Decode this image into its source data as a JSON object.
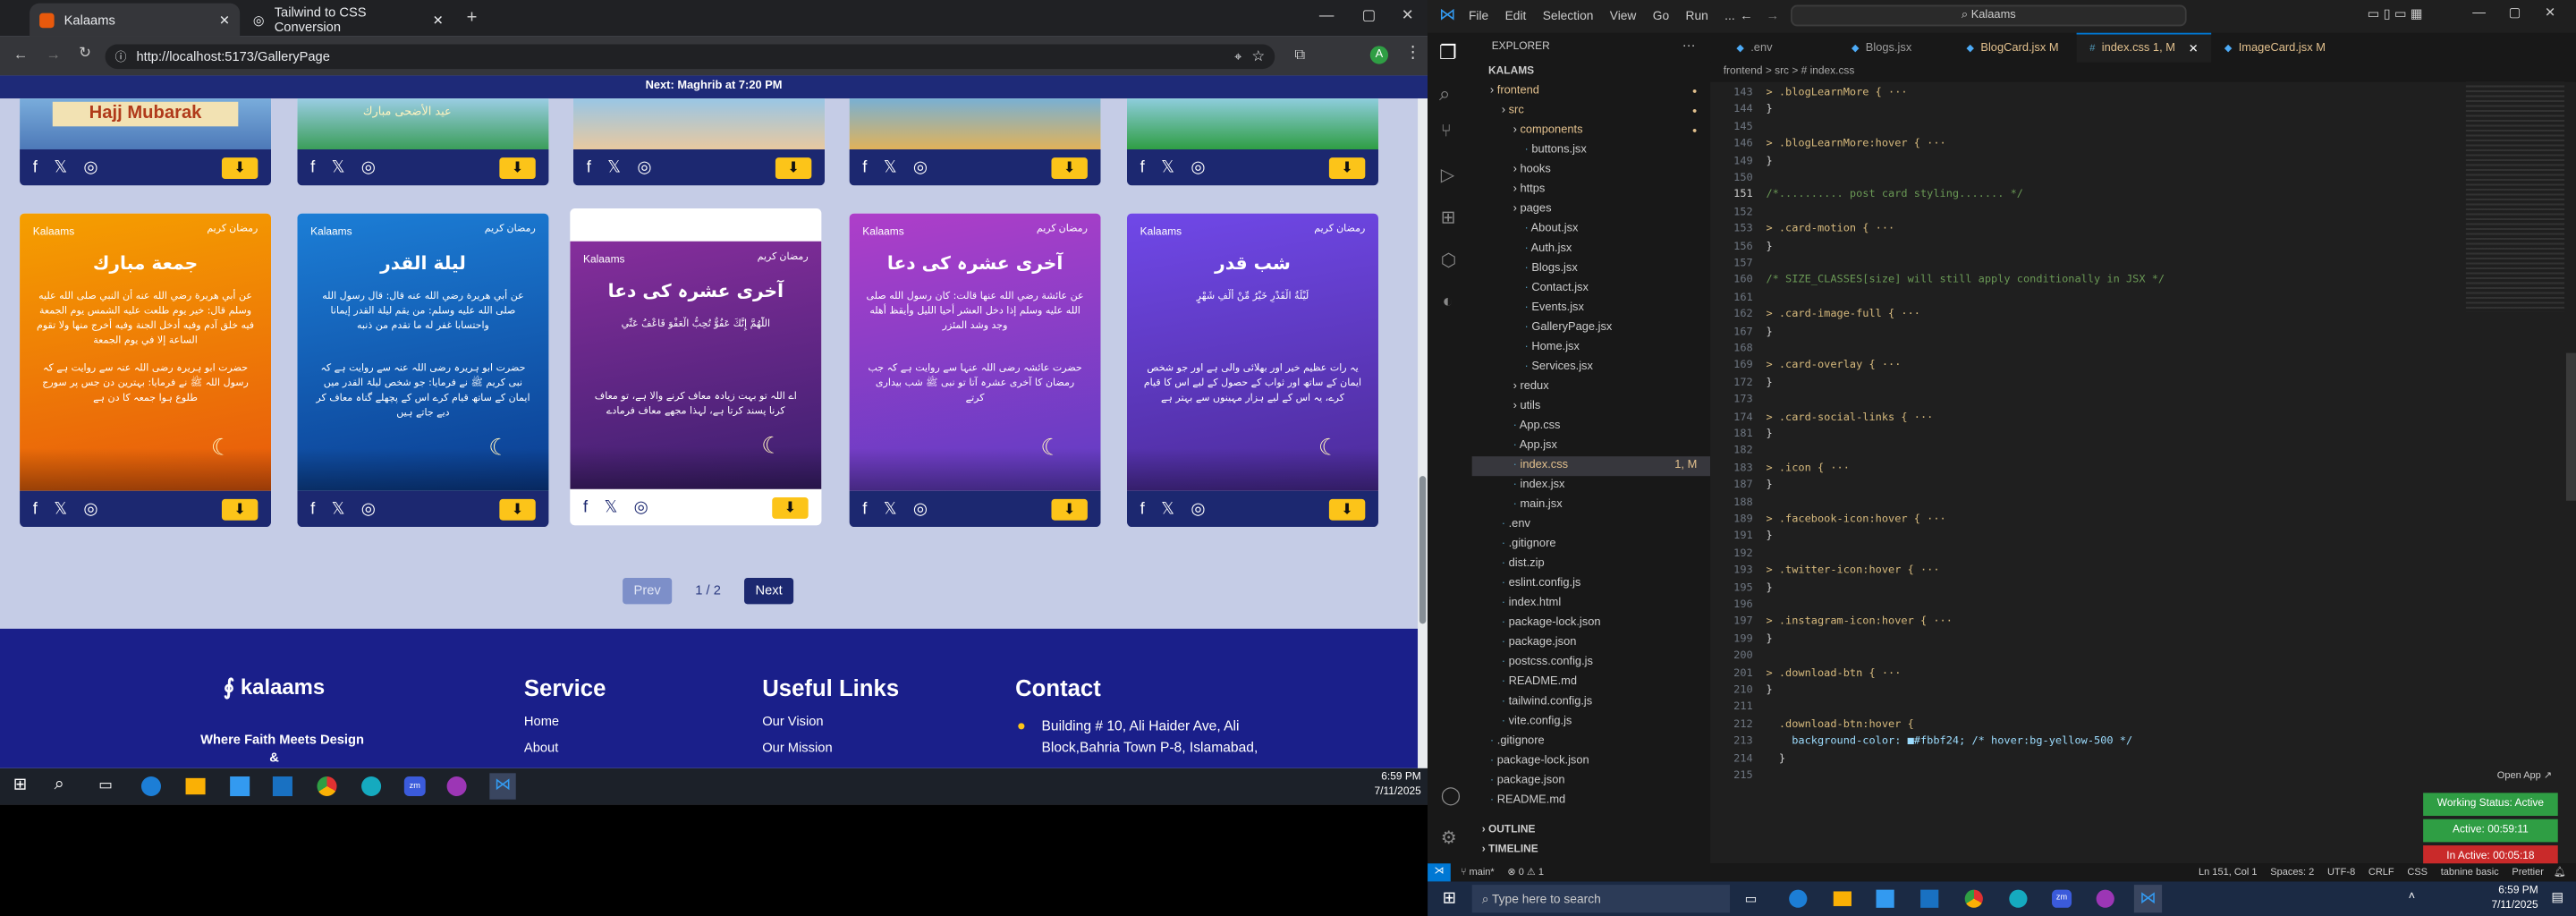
{
  "browser": {
    "tabs": [
      {
        "title": "Kalaams"
      },
      {
        "title": "Tailwind to CSS Conversion"
      }
    ],
    "url": "http://localhost:5173/GalleryPage",
    "notice": "Next: Maghrib at 7:20 PM"
  },
  "gallery": {
    "top_row_label": "Hajj Mubarak",
    "top_row_sub": "عيد الأضحى مبارك",
    "cards": [
      {
        "title": "جمعة مبارك",
        "text": "عن أبي هريرة رضي الله عنه أن النبي صلى الله عليه وسلم قال: خير يوم طلعت عليه الشمس يوم الجمعة فيه خلق آدم وفيه أدخل الجنة وفيه أخرج منها ولا تقوم الساعة إلا في يوم الجمعة",
        "urdu": "حضرت ابو ہریرہ رضی اللہ عنہ سے روایت ہے کہ رسول اللہ ﷺ نے فرمایا: بہترین دن جس پر سورج طلوع ہوا جمعہ کا دن ہے",
        "colors": [
          "#f59f00",
          "#e8590c"
        ]
      },
      {
        "title": "ليلة القدر",
        "text": "عن أبي هريرة رضي الله عنه قال: قال رسول الله صلى الله عليه وسلم: من يقم ليلة القدر إيمانا واحتسابا غفر له ما تقدم من ذنبه",
        "urdu": "حضرت ابو ہریرہ رضی اللہ عنہ سے روایت ہے کہ نبی کریم ﷺ نے فرمایا: جو شخص لیلۃ القدر میں ایمان کے ساتھ قیام کرے اس کے پچھلے گناہ معاف کر دیے جاتے ہیں",
        "colors": [
          "#1c7ed6",
          "#0b3d91"
        ]
      },
      {
        "title": "آخری عشرہ کی دعا",
        "text": "اللَّهُمَّ إِنَّكَ عَفُوٌّ تُحِبُّ الْعَفْوَ فَاعْفُ عَنِّي",
        "urdu": "اے اللہ تو بہت زیادہ معاف کرنے والا ہے، تو معاف کرنا پسند کرتا ہے، لہذا مجھے معاف فرمادے",
        "colors": [
          "#862e9c",
          "#3b1f6e"
        ]
      },
      {
        "title": "آخری عشرہ کی دعا",
        "text": "عن عائشة رضي الله عنها قالت: كان رسول الله صلى الله عليه وسلم إذا دخل العشر أحيا الليل وأيقظ أهله وجد وشد المئزر",
        "urdu": "حضرت عائشہ رضی اللہ عنہا سے روایت ہے کہ جب رمضان کا آخری عشرہ آتا تو نبی ﷺ شب بیداری کرتے",
        "colors": [
          "#ae3ec9",
          "#5f3dc4"
        ]
      },
      {
        "title": "شب قدر",
        "text": "لَيْلَةُ الْقَدْرِ خَيْرٌ مِّنْ أَلْفِ شَهْرٍ",
        "urdu": "یہ رات عظیم خیر اور بھلائی والی ہے اور جو شخص ایمان کے ساتھ اور ثواب کے حصول کے لیے اس کا قیام کرے، یہ اس کے لیے ہزار مہینوں سے بہتر ہے",
        "colors": [
          "#7048e8",
          "#4c2b99"
        ]
      }
    ],
    "card_logo": "Kalaams",
    "card_badge": "رمضان كريم"
  },
  "pagination": {
    "prev": "Prev",
    "page": "1 / 2",
    "next": "Next"
  },
  "footer": {
    "brand": "kalaams",
    "tagline": "Where Faith Meets Design",
    "tagline2": "&",
    "service": {
      "heading": "Service",
      "links": [
        "Home",
        "About"
      ]
    },
    "useful": {
      "heading": "Useful Links",
      "links": [
        "Our Vision",
        "Our Mission"
      ]
    },
    "contact": {
      "heading": "Contact",
      "address": "Building # 10, Ali Haider Ave, Ali Block,Bahria Town P-8, Islamabad,"
    }
  },
  "taskbar_left": {
    "time": "6:59 PM",
    "date": "7/11/2025"
  },
  "vscode": {
    "menu": [
      "File",
      "Edit",
      "Selection",
      "View",
      "Go",
      "Run",
      "..."
    ],
    "search": "Kalaams",
    "explorer": "EXPLORER",
    "root": "KALAMS",
    "tree": [
      {
        "name": "frontend",
        "depth": 1,
        "type": "folder",
        "mod": true
      },
      {
        "name": "src",
        "depth": 2,
        "type": "folder",
        "mod": true
      },
      {
        "name": "components",
        "depth": 3,
        "type": "folder",
        "mod": true
      },
      {
        "name": "buttons.jsx",
        "depth": 4,
        "type": "file"
      },
      {
        "name": "hooks",
        "depth": 3,
        "type": "folder"
      },
      {
        "name": "https",
        "depth": 3,
        "type": "folder"
      },
      {
        "name": "pages",
        "depth": 3,
        "type": "folder"
      },
      {
        "name": "About.jsx",
        "depth": 4,
        "type": "file"
      },
      {
        "name": "Auth.jsx",
        "depth": 4,
        "type": "file"
      },
      {
        "name": "Blogs.jsx",
        "depth": 4,
        "type": "file"
      },
      {
        "name": "Contact.jsx",
        "depth": 4,
        "type": "file"
      },
      {
        "name": "Events.jsx",
        "depth": 4,
        "type": "file"
      },
      {
        "name": "GalleryPage.jsx",
        "depth": 4,
        "type": "file"
      },
      {
        "name": "Home.jsx",
        "depth": 4,
        "type": "file"
      },
      {
        "name": "Services.jsx",
        "depth": 4,
        "type": "file"
      },
      {
        "name": "redux",
        "depth": 3,
        "type": "folder"
      },
      {
        "name": "utils",
        "depth": 3,
        "type": "folder"
      },
      {
        "name": "App.css",
        "depth": 3,
        "type": "file"
      },
      {
        "name": "App.jsx",
        "depth": 3,
        "type": "file"
      },
      {
        "name": "index.css",
        "depth": 3,
        "type": "file",
        "mod": true,
        "badge": "1, M",
        "active": true
      },
      {
        "name": "index.jsx",
        "depth": 3,
        "type": "file"
      },
      {
        "name": "main.jsx",
        "depth": 3,
        "type": "file"
      },
      {
        "name": ".env",
        "depth": 2,
        "type": "file"
      },
      {
        "name": ".gitignore",
        "depth": 2,
        "type": "file"
      },
      {
        "name": "dist.zip",
        "depth": 2,
        "type": "file"
      },
      {
        "name": "eslint.config.js",
        "depth": 2,
        "type": "file"
      },
      {
        "name": "index.html",
        "depth": 2,
        "type": "file"
      },
      {
        "name": "package-lock.json",
        "depth": 2,
        "type": "file"
      },
      {
        "name": "package.json",
        "depth": 2,
        "type": "file"
      },
      {
        "name": "postcss.config.js",
        "depth": 2,
        "type": "file"
      },
      {
        "name": "README.md",
        "depth": 2,
        "type": "file"
      },
      {
        "name": "tailwind.config.js",
        "depth": 2,
        "type": "file"
      },
      {
        "name": "vite.config.js",
        "depth": 2,
        "type": "file"
      },
      {
        "name": ".gitignore",
        "depth": 1,
        "type": "file"
      },
      {
        "name": "package-lock.json",
        "depth": 1,
        "type": "file"
      },
      {
        "name": "package.json",
        "depth": 1,
        "type": "file"
      },
      {
        "name": "README.md",
        "depth": 1,
        "type": "file"
      }
    ],
    "outline": "OUTLINE",
    "timeline": "TIMELINE",
    "tabs": [
      ".env",
      "Blogs.jsx",
      "BlogCard.jsx M",
      "index.css 1, M",
      "ImageCard.jsx M"
    ],
    "breadcrumb": "frontend > src > # index.css",
    "lines": [
      {
        "n": "143",
        "t": "> .blogLearnMore { ···"
      },
      {
        "n": "144",
        "t": "}"
      },
      {
        "n": "145",
        "t": ""
      },
      {
        "n": "146",
        "t": "> .blogLearnMore:hover { ···"
      },
      {
        "n": "149",
        "t": "}"
      },
      {
        "n": "150",
        "t": ""
      },
      {
        "n": "151",
        "t": "/*.......... post card styling....... */"
      },
      {
        "n": "152",
        "t": ""
      },
      {
        "n": "153",
        "t": "> .card-motion { ···"
      },
      {
        "n": "156",
        "t": "}"
      },
      {
        "n": "157",
        "t": ""
      },
      {
        "n": "160",
        "t": "/* SIZE_CLASSES[size] will still apply conditionally in JSX */"
      },
      {
        "n": "161",
        "t": ""
      },
      {
        "n": "162",
        "t": "> .card-image-full { ···"
      },
      {
        "n": "167",
        "t": "}"
      },
      {
        "n": "168",
        "t": ""
      },
      {
        "n": "169",
        "t": "> .card-overlay { ···"
      },
      {
        "n": "172",
        "t": "}"
      },
      {
        "n": "173",
        "t": ""
      },
      {
        "n": "174",
        "t": "> .card-social-links { ···"
      },
      {
        "n": "181",
        "t": "}"
      },
      {
        "n": "182",
        "t": ""
      },
      {
        "n": "183",
        "t": "> .icon { ···"
      },
      {
        "n": "187",
        "t": "}"
      },
      {
        "n": "188",
        "t": ""
      },
      {
        "n": "189",
        "t": "> .facebook-icon:hover { ···"
      },
      {
        "n": "191",
        "t": "}"
      },
      {
        "n": "192",
        "t": ""
      },
      {
        "n": "193",
        "t": "> .twitter-icon:hover { ···"
      },
      {
        "n": "195",
        "t": "}"
      },
      {
        "n": "196",
        "t": ""
      },
      {
        "n": "197",
        "t": "> .instagram-icon:hover { ···"
      },
      {
        "n": "199",
        "t": "}"
      },
      {
        "n": "200",
        "t": ""
      },
      {
        "n": "201",
        "t": "> .download-btn { ···"
      },
      {
        "n": "210",
        "t": "}"
      },
      {
        "n": "211",
        "t": ""
      },
      {
        "n": "212",
        "t": "  .download-btn:hover {"
      },
      {
        "n": "213",
        "t": "    background-color: ■#fbbf24; /* hover:bg-yellow-500 */"
      },
      {
        "n": "214",
        "t": "  }"
      },
      {
        "n": "215",
        "t": ""
      }
    ],
    "status": {
      "branch": "main*",
      "problems": "⊗ 0 ⚠ 1",
      "ln": "Ln 151, Col 1",
      "spaces": "Spaces: 2",
      "enc": "UTF-8",
      "eol": "CRLF",
      "lang": "CSS",
      "ext": "tabnine basic",
      "prettier": "Prettier"
    },
    "open_app": "Open App ↗",
    "working": "Working Status: Active",
    "active": "Active: 00:59:11",
    "inactive": "In Active: 00:05:18"
  },
  "taskbar_right": {
    "search": "Type here to search",
    "time": "6:59 PM",
    "date": "7/11/2025"
  }
}
